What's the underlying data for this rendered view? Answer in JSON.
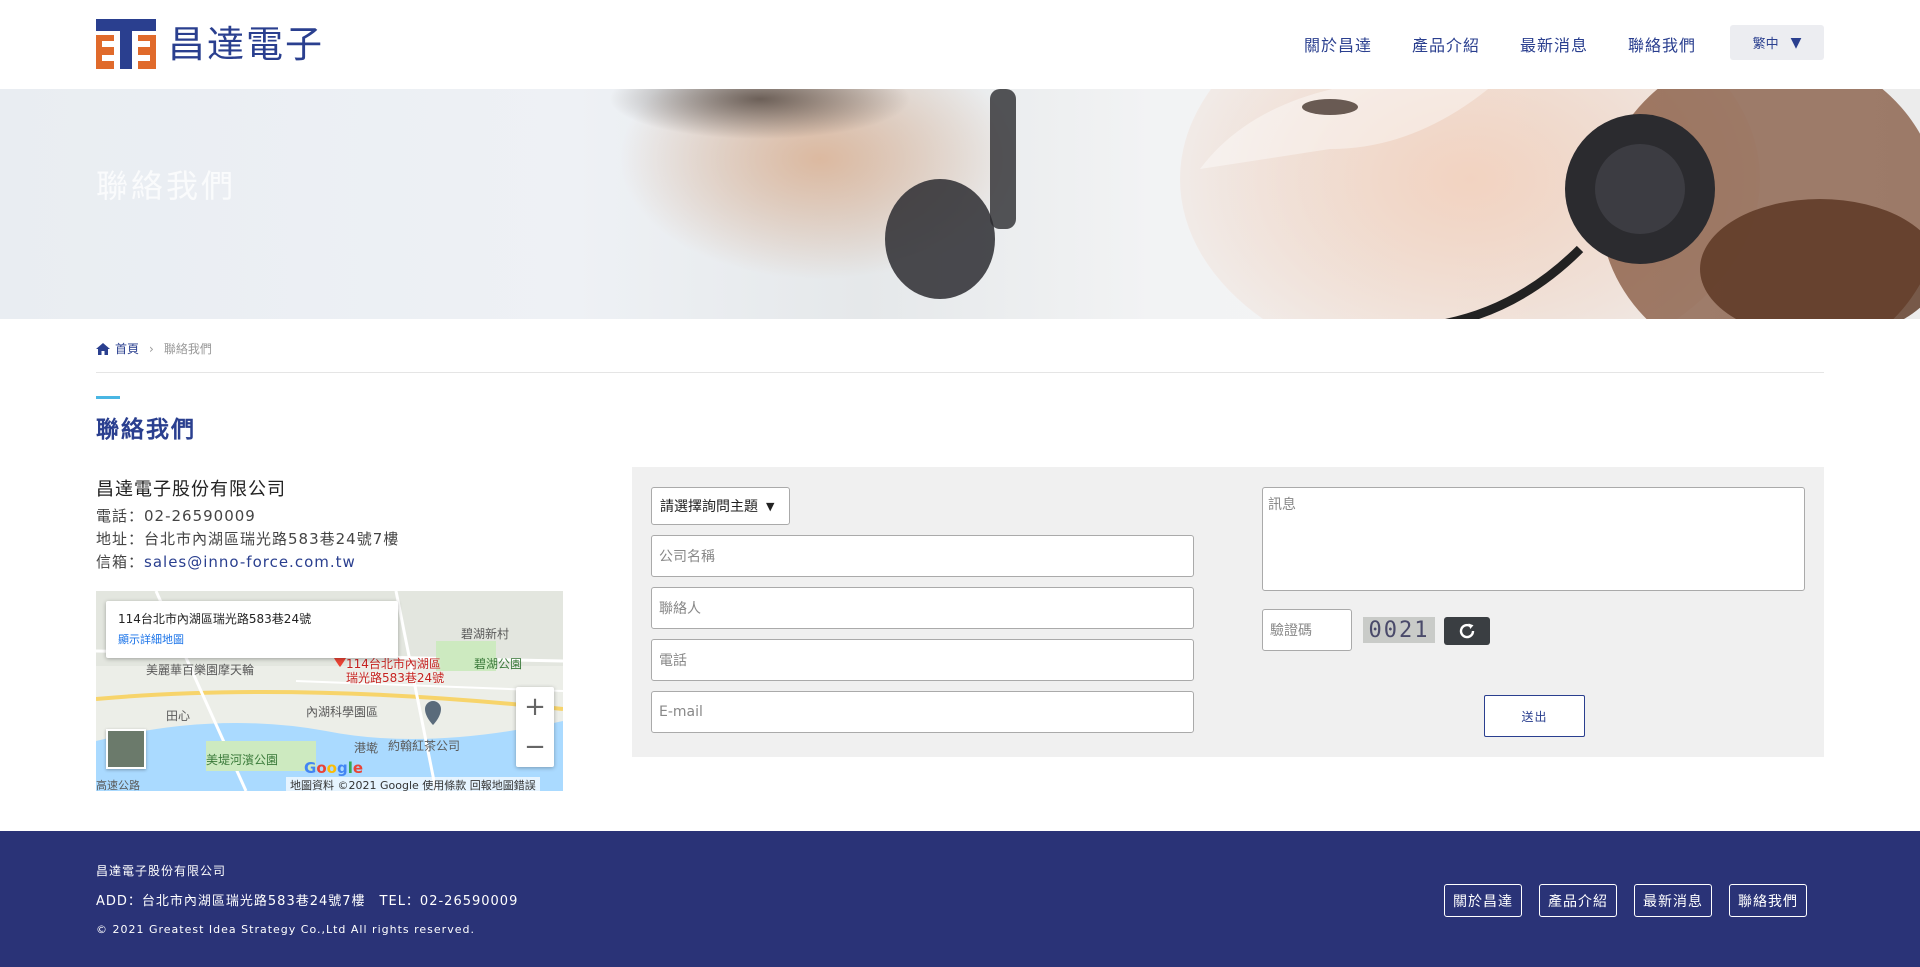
{
  "header": {
    "logo_text": "昌達電子",
    "nav": [
      {
        "label": "關於昌達"
      },
      {
        "label": "產品介紹"
      },
      {
        "label": "最新消息"
      },
      {
        "label": "聯絡我們"
      }
    ],
    "language": "繁中"
  },
  "banner": {
    "title": "聯絡我們"
  },
  "breadcrumb": {
    "home": "首頁",
    "separator": "›",
    "current": "聯絡我們"
  },
  "page_title": "聯絡我們",
  "company": {
    "name": "昌達電子股份有限公司",
    "phone": "電話：02-26590009",
    "address": "地址：台北市內湖區瑞光路583巷24號7樓",
    "email_label": "信箱：",
    "email": "sales@inno-force.com.tw"
  },
  "map": {
    "card_address": "114台北市內湖區瑞光路583巷24號",
    "card_link": "顯示詳細地圖",
    "pin_label_1": "114台北市內湖區",
    "pin_label_2": "瑞光路583巷24號",
    "labels": {
      "a": "碧湖新村",
      "b": "碧湖公園",
      "c": "美麗華百樂園摩天輪",
      "d": "內湖科學園區",
      "e": "約翰紅茶公司",
      "f": "美堤河濱公園",
      "g": "港墘",
      "h": "田心",
      "i": "高速公路"
    },
    "zoom_in": "+",
    "zoom_out": "−",
    "google": "Google",
    "footer": "地圖資料 ©2021 Google   使用條款   回報地圖錯誤"
  },
  "form": {
    "subject_select": "請選擇詢問主題",
    "company_placeholder": "公司名稱",
    "contact_placeholder": "聯絡人",
    "phone_placeholder": "電話",
    "email_placeholder": "E-mail",
    "message_placeholder": "訊息",
    "captcha_placeholder": "驗證碼",
    "captcha_value": "0021",
    "submit": "送出"
  },
  "footer": {
    "company": "昌達電子股份有限公司",
    "address": "ADD：台北市內湖區瑞光路583巷24號7樓　TEL：02-26590009",
    "copyright": "© 2021 Greatest Idea Strategy Co.,Ltd All rights reserved.",
    "nav": [
      {
        "label": "關於昌達"
      },
      {
        "label": "產品介紹"
      },
      {
        "label": "最新消息"
      },
      {
        "label": "聯絡我們"
      }
    ]
  },
  "colors": {
    "brand_blue": "#2a3f8f",
    "logo_orange": "#e06a2b",
    "footer_bg": "#2a3377",
    "accent": "#49b6e3"
  }
}
